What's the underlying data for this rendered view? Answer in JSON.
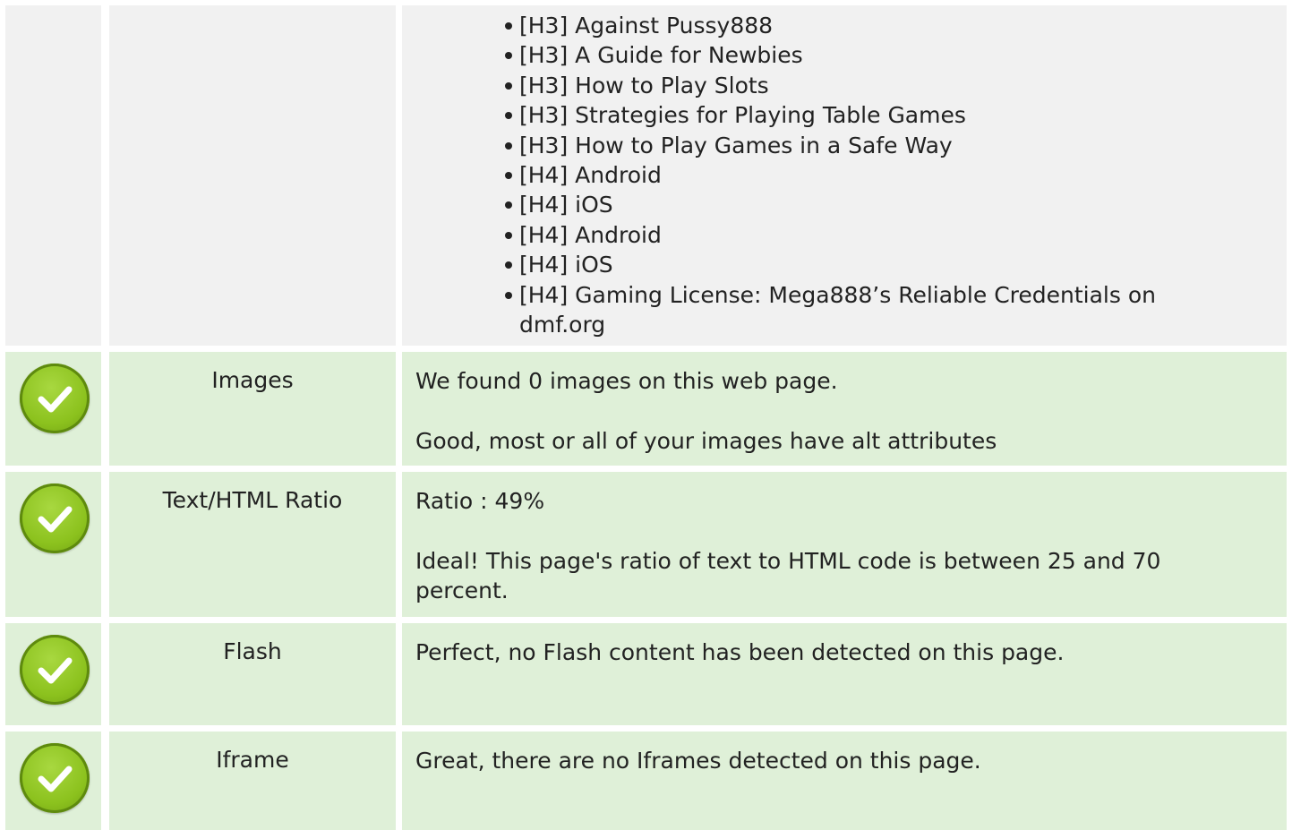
{
  "headings": [
    "[H3] Against Pussy888",
    "[H3] A Guide for Newbies",
    "[H3] How to Play Slots",
    "[H3] Strategies for Playing Table Games",
    "[H3] How to Play Games in a Safe Way",
    "[H4] Android",
    "[H4] iOS",
    "[H4] Android",
    "[H4] iOS",
    "[H4] Gaming License: Mega888’s Reliable Credentials on dmf.org"
  ],
  "checks": [
    {
      "label": "Images",
      "status_icon": "check-circle-icon",
      "lines": [
        "We found 0 images on this web page.",
        "Good, most or all of your images have alt attributes"
      ]
    },
    {
      "label": "Text/HTML Ratio",
      "status_icon": "check-circle-icon",
      "lines": [
        "Ratio : 49%",
        "Ideal! This page's ratio of text to HTML code is between 25 and 70 percent."
      ]
    },
    {
      "label": "Flash",
      "status_icon": "check-circle-icon",
      "lines": [
        "Perfect, no Flash content has been detected on this page."
      ]
    },
    {
      "label": "Iframe",
      "status_icon": "check-circle-icon",
      "lines": [
        "Great, there are no Iframes detected on this page."
      ]
    }
  ],
  "colors": {
    "row_grey": "#f1f1f1",
    "row_green": "#dff0d8",
    "check_green": "#8cc21e"
  }
}
